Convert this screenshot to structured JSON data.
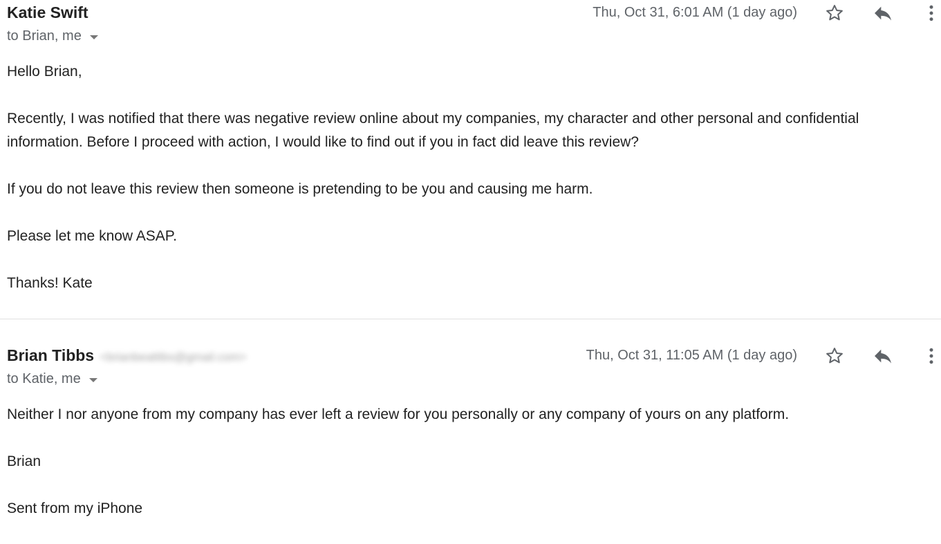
{
  "thread": {
    "messages": [
      {
        "sender_name": "Katie Swift",
        "sender_email": "",
        "recipients": "to Brian, me",
        "timestamp": "Thu, Oct 31, 6:01 AM (1 day ago)",
        "star_icon": "star-outline-icon",
        "reply_icon": "reply-icon",
        "more_icon": "more-vertical-icon",
        "paragraphs": [
          "Hello Brian,",
          "Recently, I was notified that there was negative review online about my companies, my character and other personal and confidential information. Before I proceed with action, I would like to find out if you in fact did leave this review?",
          "If you do not leave this review then someone is pretending to be you and causing me harm.",
          "Please let me know ASAP.",
          "Thanks! Kate"
        ]
      },
      {
        "sender_name": "Brian Tibbs",
        "sender_email": "<brianbeattibs@gmail.com>",
        "recipients": "to Katie, me",
        "timestamp": "Thu, Oct 31, 11:05 AM (1 day ago)",
        "star_icon": "star-outline-icon",
        "reply_icon": "reply-icon",
        "more_icon": "more-vertical-icon",
        "paragraphs": [
          "Neither I nor anyone from my company has ever left a review for you personally or any company of yours on any platform.",
          "Brian",
          "Sent from my iPhone"
        ]
      }
    ]
  },
  "colors": {
    "text_primary": "#222222",
    "text_secondary": "#5f6368",
    "icon": "#5f6368",
    "divider": "#e0e0e0",
    "background": "#ffffff"
  }
}
